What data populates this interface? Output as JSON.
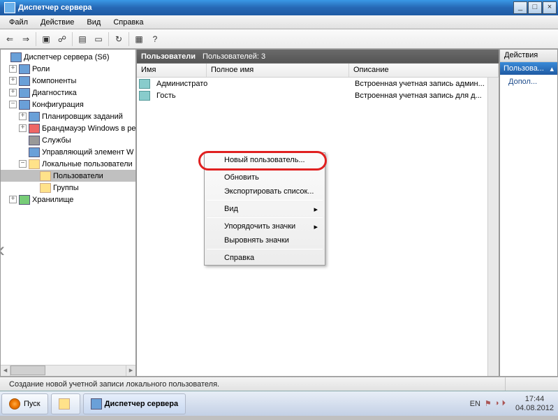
{
  "window": {
    "title": "Диспетчер сервера"
  },
  "menubar": {
    "file": "Файл",
    "action": "Действие",
    "view": "Вид",
    "help": "Справка"
  },
  "tree": {
    "root": "Диспетчер сервера (S6)",
    "roles": "Роли",
    "components": "Компоненты",
    "diagnostics": "Диагностика",
    "config": "Конфигурация",
    "scheduler": "Планировщик заданий",
    "firewall": "Брандмауэр Windows в ре",
    "services": "Службы",
    "wmi": "Управляющий элемент W",
    "localusers": "Локальные пользователи",
    "users": "Пользователи",
    "groups": "Группы",
    "storage": "Хранилище"
  },
  "mid": {
    "title": "Пользователи",
    "count_label": "Пользователей: 3",
    "cols": {
      "name": "Имя",
      "fullname": "Полное имя",
      "desc": "Описание"
    },
    "rows": [
      {
        "name": "Администратор",
        "full": "",
        "desc": "Встроенная учетная запись админ..."
      },
      {
        "name": "Гость",
        "full": "",
        "desc": "Встроенная учетная запись для д..."
      }
    ]
  },
  "context": {
    "new_user": "Новый пользователь...",
    "refresh": "Обновить",
    "export": "Экспортировать список...",
    "view": "Вид",
    "arrange": "Упорядочить значки",
    "align": "Выровнять значки",
    "help": "Справка"
  },
  "actions": {
    "header": "Действия",
    "section": "Пользова...",
    "more": "Допол..."
  },
  "statusbar": {
    "text": "Создание новой учетной записи локального пользователя."
  },
  "taskbar": {
    "start": "Пуск",
    "app": "Диспетчер сервера",
    "lang": "EN",
    "time": "17:44",
    "date": "04.08.2012"
  }
}
